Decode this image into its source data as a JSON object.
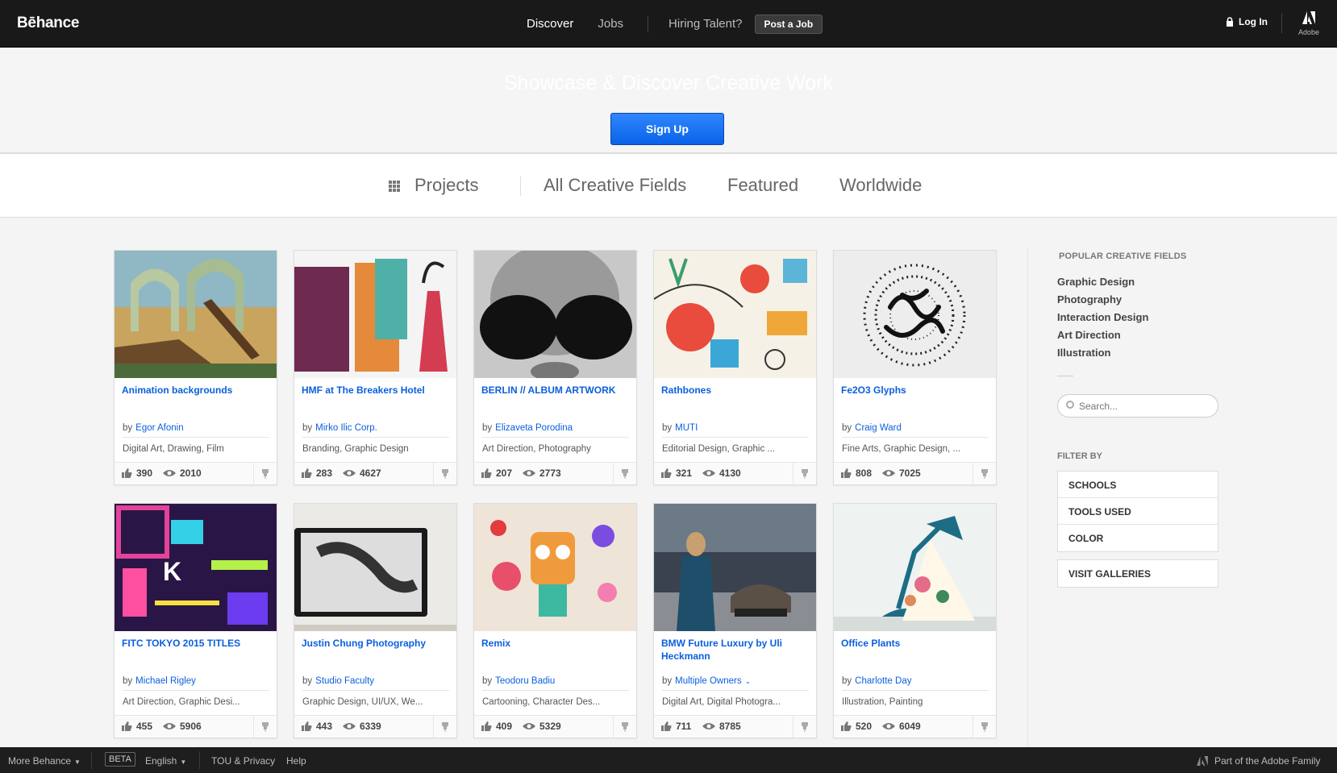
{
  "brand": {
    "logo": "Bēhance"
  },
  "nav": {
    "discover": "Discover",
    "jobs": "Jobs",
    "hiring": "Hiring Talent?",
    "post_job": "Post a Job",
    "login": "Log In",
    "adobe_label": "Adobe"
  },
  "hero": {
    "title": "Showcase & Discover Creative Work",
    "signup": "Sign Up"
  },
  "filters": {
    "projects": "Projects",
    "fields": "All Creative Fields",
    "featured": "Featured",
    "worldwide": "Worldwide"
  },
  "projects": [
    {
      "title": "Animation backgrounds",
      "by": "by",
      "owner": "Egor Afonin",
      "fields": "Digital Art, Drawing, Film",
      "appreciations": "390",
      "views": "2010"
    },
    {
      "title": "HMF at The Breakers Hotel",
      "by": "by",
      "owner": "Mirko Ilic Corp.",
      "fields": "Branding, Graphic Design",
      "appreciations": "283",
      "views": "4627"
    },
    {
      "title": "BERLIN // ALBUM ARTWORK",
      "by": "by",
      "owner": "Elizaveta Porodina",
      "fields": "Art Direction, Photography",
      "appreciations": "207",
      "views": "2773"
    },
    {
      "title": "Rathbones",
      "by": "by",
      "owner": "MUTI",
      "fields": "Editorial Design, Graphic ...",
      "appreciations": "321",
      "views": "4130"
    },
    {
      "title": "Fe2O3 Glyphs",
      "by": "by",
      "owner": "Craig Ward",
      "fields": "Fine Arts, Graphic Design, ...",
      "appreciations": "808",
      "views": "7025"
    },
    {
      "title": "FITC TOKYO 2015 TITLES",
      "by": "by",
      "owner": "Michael Rigley",
      "fields": "Art Direction, Graphic Desi...",
      "appreciations": "455",
      "views": "5906"
    },
    {
      "title": "Justin Chung Photography",
      "by": "by",
      "owner": "Studio Faculty",
      "fields": "Graphic Design, UI/UX, We...",
      "appreciations": "443",
      "views": "6339"
    },
    {
      "title": "Remix",
      "by": "by",
      "owner": "Teodoru Badiu",
      "fields": "Cartooning, Character Des...",
      "appreciations": "409",
      "views": "5329"
    },
    {
      "title": "BMW Future Luxury by Uli Heckmann",
      "by": "by",
      "owner": "Multiple Owners",
      "fields": "Digital Art, Digital Photogra...",
      "appreciations": "711",
      "views": "8785"
    },
    {
      "title": "Office Plants",
      "by": "by",
      "owner": "Charlotte Day",
      "fields": "Illustration, Painting",
      "appreciations": "520",
      "views": "6049"
    }
  ],
  "sidebar": {
    "popular_heading": "POPULAR CREATIVE FIELDS",
    "popular": [
      "Graphic Design",
      "Photography",
      "Interaction Design",
      "Art Direction",
      "Illustration"
    ],
    "search_placeholder": "Search...",
    "filter_heading": "FILTER BY",
    "filter_options": [
      "SCHOOLS",
      "TOOLS USED",
      "COLOR"
    ],
    "galleries": "VISIT GALLERIES"
  },
  "footer": {
    "more": "More Behance",
    "beta": "BETA",
    "language": "English",
    "tou": "TOU & Privacy",
    "help": "Help",
    "adobe_family": "Part of the Adobe Family"
  },
  "colors": {
    "link": "#0b5fde",
    "signup": "#1a74f2",
    "topbar": "#191919"
  }
}
